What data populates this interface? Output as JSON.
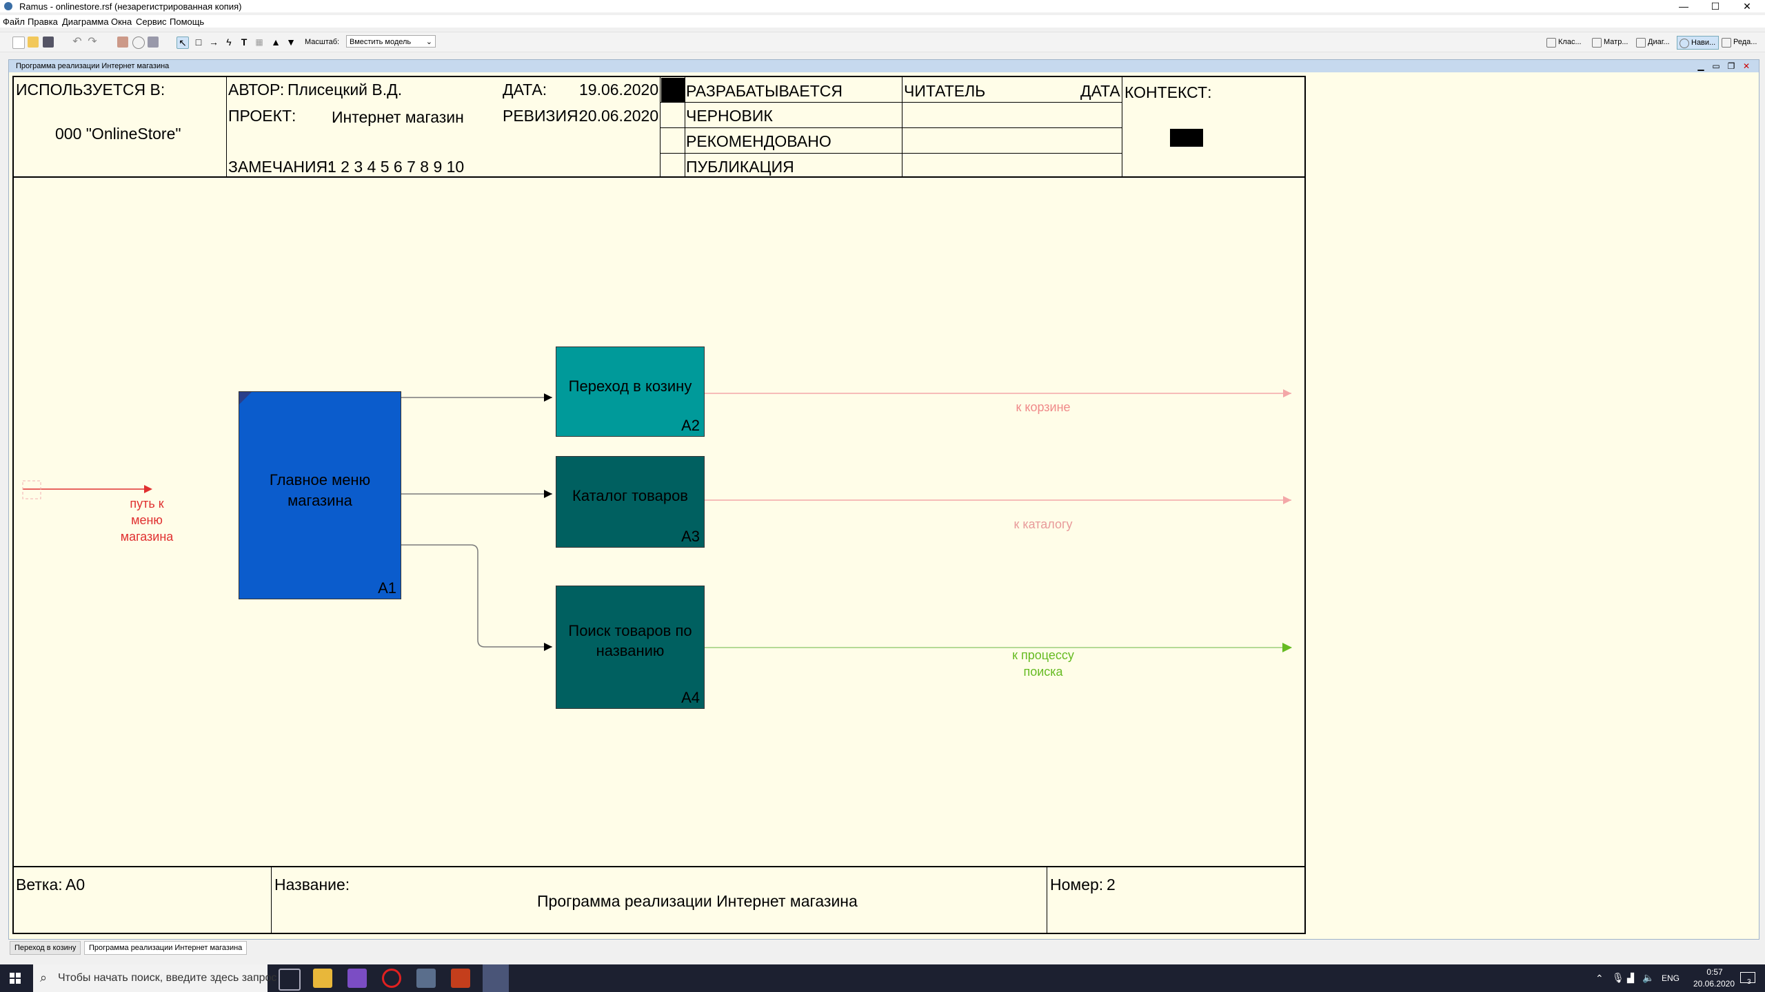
{
  "window": {
    "title": "Ramus - onlinestore.rsf (незарегистрированная копия)",
    "minimize": "—",
    "maximize": "☐",
    "close": "✕"
  },
  "menu": [
    "Файл",
    "Правка",
    "Диаграмма",
    "Окна",
    "Сервис",
    "Помощь"
  ],
  "toolbar": {
    "zoom_label": "Масштаб:",
    "zoom_value": "Вместить модель",
    "right_tools": [
      "Клас...",
      "Матр...",
      "Диаг...",
      "Нави...",
      "Реда..."
    ]
  },
  "document": {
    "title": "Программа реализации Интернет магазина"
  },
  "header": {
    "used_in_label": "ИСПОЛЬЗУЕТСЯ В:",
    "used_in_value": "000 \"OnlineStore\"",
    "author_label": "АВТОР:",
    "author_value": "Плисецкий В.Д.",
    "project_label": "ПРОЕКТ:",
    "project_value": "Интернет магазин",
    "date_label": "ДАТА:",
    "date_value": "19.06.2020",
    "revision_label": "РЕВИЗИЯ:",
    "revision_value": "20.06.2020",
    "notes_label": "ЗАМЕЧАНИЯ:",
    "notes_value": "1 2 3 4 5 6 7 8 9 10",
    "status": [
      "РАЗРАБАТЫВАЕТСЯ",
      "ЧЕРНОВИК",
      "РЕКОМЕНДОВАНО",
      "ПУБЛИКАЦИЯ"
    ],
    "reader_label": "ЧИТАТЕЛЬ",
    "reader_date_label": "ДАТА",
    "context_label": "КОНТЕКСТ:"
  },
  "diagram": {
    "boxes": [
      {
        "name": "Главное меню магазина",
        "number": "А1",
        "color": "#0b5ccc"
      },
      {
        "name": "Переход в козину",
        "number": "А2",
        "color": "#009a9a"
      },
      {
        "name": "Каталог товаров",
        "number": "А3",
        "color": "#006060"
      },
      {
        "name": "Поиск товаров по названию",
        "number": "А4",
        "color": "#006060"
      }
    ],
    "arrows": [
      {
        "label": "путь к меню магазина",
        "color": "#e03030"
      },
      {
        "label": "к корзине",
        "color": "#f08a8a"
      },
      {
        "label": "к каталогу",
        "color": "#e89a9a"
      },
      {
        "label": "к процессу поиска",
        "color": "#66bb22"
      }
    ]
  },
  "footer": {
    "node_label": "Ветка:",
    "node_value": "А0",
    "title_label": "Название:",
    "title_value": "Программа реализации Интернет магазина",
    "number_label": "Номер:",
    "number_value": "2"
  },
  "tabs": [
    "Переход в козину",
    "Программа реализации Интернет магазина"
  ],
  "taskbar": {
    "search_placeholder": "Чтобы начать поиск, введите здесь запрос",
    "language": "ENG",
    "time": "0:57",
    "date": "20.06.2020",
    "notification_count": "3"
  }
}
